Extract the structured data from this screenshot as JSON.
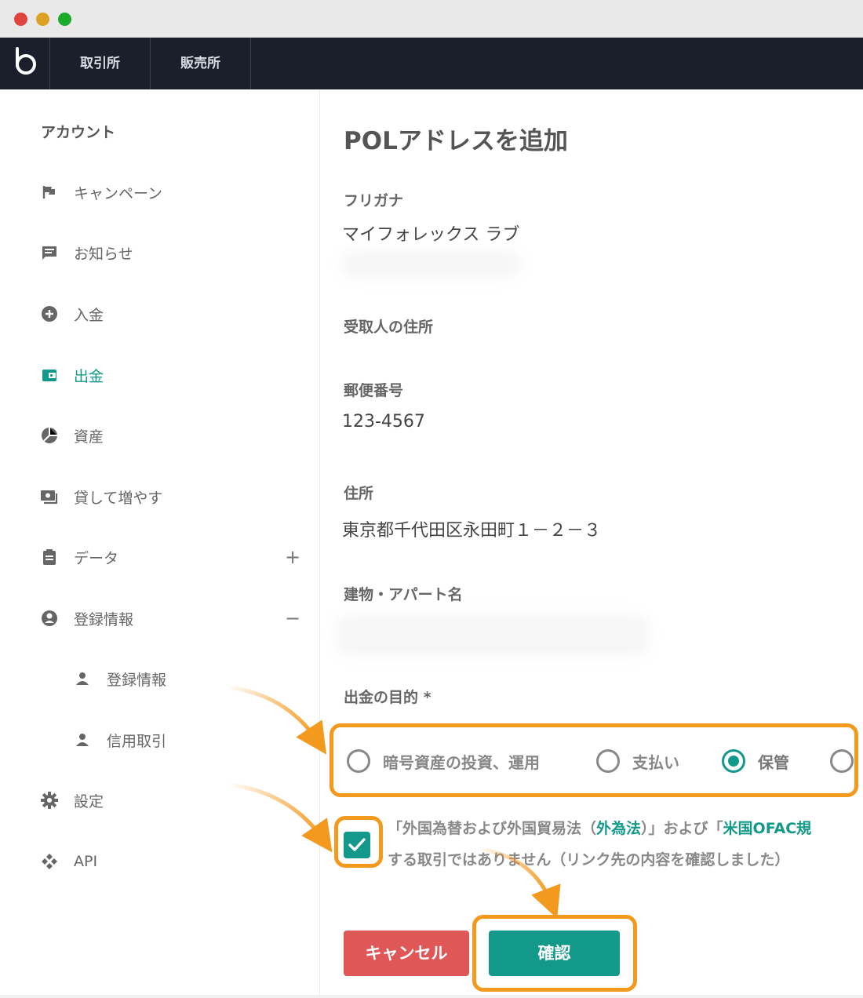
{
  "nav": {
    "tabs": [
      "取引所",
      "販売所"
    ]
  },
  "sidebar": {
    "title": "アカウント",
    "items": [
      {
        "label": "キャンペーン",
        "icon": "flag-icon"
      },
      {
        "label": "お知らせ",
        "icon": "message-icon"
      },
      {
        "label": "入金",
        "icon": "plus-circle-icon"
      },
      {
        "label": "出金",
        "icon": "wallet-icon",
        "active": true
      },
      {
        "label": "資産",
        "icon": "pie-chart-icon"
      },
      {
        "label": "貸して増やす",
        "icon": "money-icon"
      },
      {
        "label": "データ",
        "icon": "clipboard-icon",
        "toggle": "+"
      },
      {
        "label": "登録情報",
        "icon": "account-circle-icon",
        "toggle": "−"
      },
      {
        "label": "登録情報",
        "icon": "person-icon",
        "sub": true
      },
      {
        "label": "信用取引",
        "icon": "person-icon",
        "sub": true
      },
      {
        "label": "設定",
        "icon": "gear-icon"
      },
      {
        "label": "API",
        "icon": "api-icon"
      }
    ]
  },
  "main": {
    "title": "POLアドレスを追加",
    "furigana_label": "フリガナ",
    "furigana_value": "マイフォレックス ラブ",
    "address_section": "受取人の住所",
    "postal_label": "郵便番号",
    "postal_value": "123-4567",
    "address_label": "住所",
    "address_value": "東京都千代田区永田町１－２－３",
    "building_label": "建物・アパート名",
    "purpose_label": "出金の目的 *",
    "purpose_options": [
      "暗号資産の投資、運用",
      "支払い",
      "保管"
    ],
    "purpose_selected": "保管",
    "consent_line1_pre": "「外国為替および外国貿易法（",
    "consent_link1": "外為法",
    "consent_line1_mid": "）」および「",
    "consent_link2": "米国OFAC規",
    "consent_line2": "する取引ではありません（リンク先の内容を確認しました）",
    "cancel_label": "キャンセル",
    "confirm_label": "確認"
  },
  "colors": {
    "accent": "#13998a",
    "highlight": "#f39a1e",
    "cancel": "#e05757",
    "nav_bg": "#1b1f2b"
  }
}
